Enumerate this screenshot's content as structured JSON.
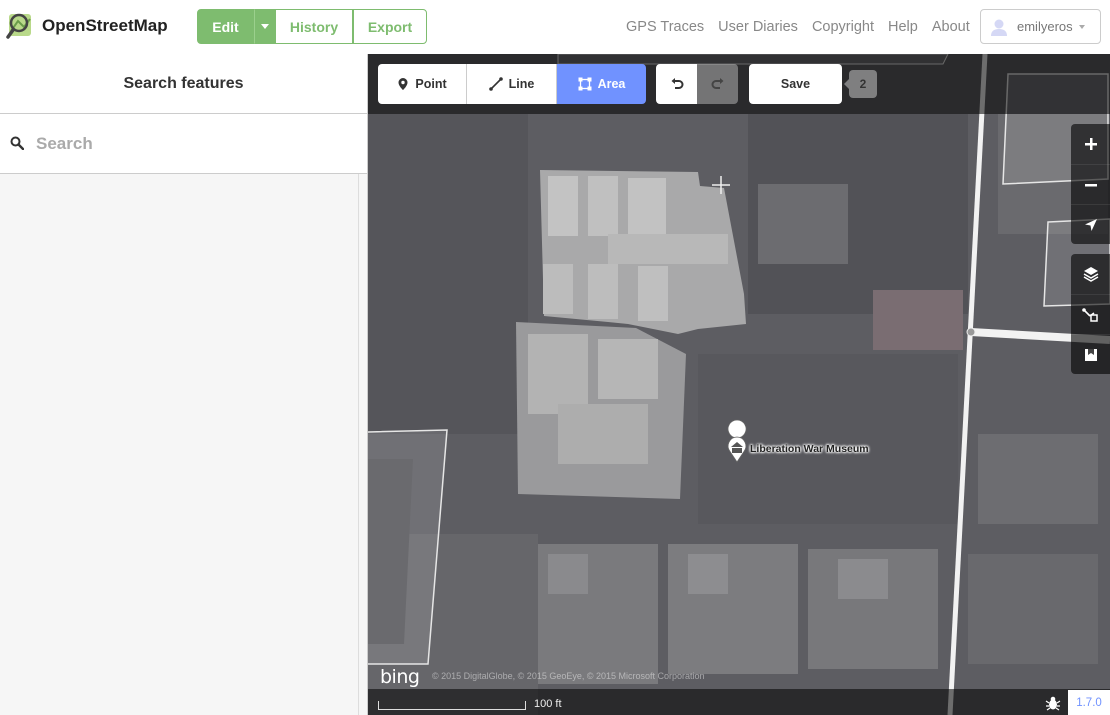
{
  "header": {
    "logo_text": "OpenStreetMap",
    "edit_label": "Edit",
    "history_label": "History",
    "export_label": "Export",
    "nav": [
      "GPS Traces",
      "User Diaries",
      "Copyright",
      "Help",
      "About"
    ],
    "username": "emilyeros",
    "accent_color": "#7ebc6f"
  },
  "sidebar": {
    "title": "Search features",
    "search_placeholder": "Search"
  },
  "toolbar": {
    "point_label": "Point",
    "line_label": "Line",
    "area_label": "Area",
    "save_label": "Save",
    "change_count": "2",
    "active_mode": "Area",
    "active_color": "#7092ff"
  },
  "map": {
    "poi_label": "Liberation War Museum",
    "poi_icon": "museum-icon",
    "imagery_logo": "bing",
    "attribution": "© 2015 DigitalGlobe, © 2015 GeoEye, © 2015 Microsoft Corporation",
    "scale_label": "100 ft",
    "version": "1.7.0",
    "controls": [
      "zoom-in-icon",
      "zoom-out-icon",
      "geolocate-icon",
      "layers-icon",
      "map-data-icon",
      "help-icon"
    ]
  }
}
